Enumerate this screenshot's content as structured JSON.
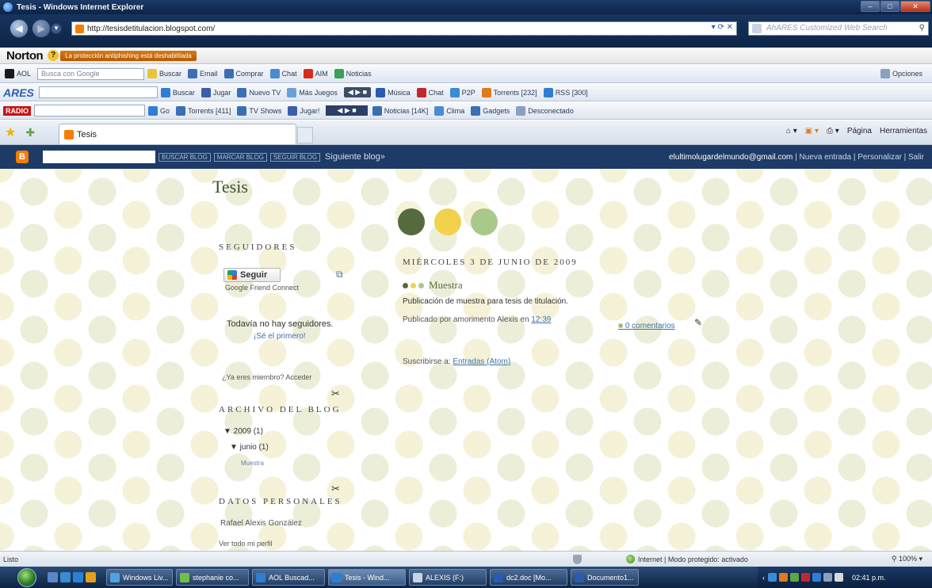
{
  "window": {
    "title": "Tesis - Windows Internet Explorer",
    "min": "–",
    "max": "□",
    "close": "✕"
  },
  "address": {
    "url": "http://tesisdetitulacion.blogspot.com/",
    "search_placeholder": "AhARES Customized Web Search"
  },
  "norton": {
    "logo": "Norton",
    "status": "La protección antiphishing está deshabilitada"
  },
  "aol": {
    "label": "AOL",
    "search_placeholder": "Busca con Google",
    "items": [
      "Buscar",
      "Email",
      "Comprar",
      "Chat",
      "AIM",
      "Noticias"
    ],
    "right": "Opciones"
  },
  "ares": {
    "logo": "ARES",
    "items": [
      "Buscar",
      "Jugar",
      "Nuevo TV",
      "Más Juegos",
      "Música",
      "Chat",
      "P2P",
      "Torrents [232]",
      "RSS [300]"
    ]
  },
  "radio": {
    "logo": "RADIO",
    "items": [
      "Go",
      "Torrents [411]",
      "TV Shows",
      "Jugar!",
      "Noticias [14K]",
      "Clima",
      "Gadgets",
      "Desconectado"
    ]
  },
  "tabs": {
    "active": "Tesis",
    "commands": [
      "Página",
      "Herramientas"
    ]
  },
  "navbar": {
    "buttons": [
      "BUSCAR BLOG",
      "MARCAR BLOG",
      "SEGUIR BLOG"
    ],
    "next": "Siguiente blog»",
    "email": "elultimolugardelmundo@gmail.com",
    "links": "| Nueva entrada | Personalizar | Salir"
  },
  "blog": {
    "title": "Tesis",
    "followers_heading": "SEGUIDORES",
    "follow_button": "Seguir",
    "gfc": "Google Friend Connect",
    "no_followers": "Todavía no hay seguidores.",
    "be_first": "¡Sé el primero!",
    "already_member": "¿Ya eres miembro? Acceder",
    "archive_heading": "ARCHIVO DEL BLOG",
    "archive_year": "▼ 2009 (1)",
    "archive_month": "▼ junio (1)",
    "archive_post": "Muestra",
    "about_heading": "DATOS PERSONALES",
    "author": "Rafael Alexis González",
    "view_profile": "Ver todo mi perfil",
    "post_date": "MIÉRCOLES 3 DE JUNIO DE 2009",
    "post_title": "Muestra",
    "post_body": "Publicación de muestra para tesis de titulación.",
    "post_meta": "Publicado por amorimento Alexis en",
    "post_time": "12:39",
    "comments": "0 comentarios",
    "subscribe": "Suscribirse a:",
    "subscribe_link": "Entradas (Atom)"
  },
  "status": {
    "left": "Listo",
    "zone": "Internet | Modo protegido: activado",
    "zoom": "100%"
  },
  "taskbar": {
    "tasks": [
      "Windows Liv...",
      "stephanie co...",
      "AOL Buscad...",
      "Tesis - Wind...",
      "ALEXIS (F:)",
      "dc2.doc [Mo...",
      "Documento1..."
    ],
    "clock": "02:41 p.m."
  },
  "colors": {
    "dot1": "#556b3e",
    "dot2": "#f2d24c",
    "dot3": "#a9c98b",
    "navbar": "#1e3a66"
  }
}
